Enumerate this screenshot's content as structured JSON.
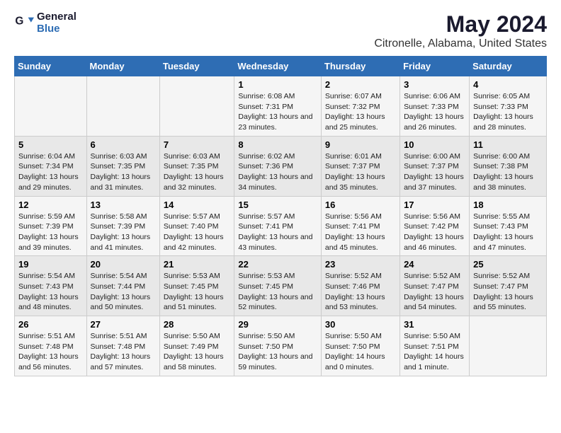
{
  "header": {
    "logo_line1": "General",
    "logo_line2": "Blue",
    "main_title": "May 2024",
    "subtitle": "Citronelle, Alabama, United States"
  },
  "weekdays": [
    "Sunday",
    "Monday",
    "Tuesday",
    "Wednesday",
    "Thursday",
    "Friday",
    "Saturday"
  ],
  "weeks": [
    [
      {
        "day": "",
        "info": ""
      },
      {
        "day": "",
        "info": ""
      },
      {
        "day": "",
        "info": ""
      },
      {
        "day": "1",
        "info": "Sunrise: 6:08 AM\nSunset: 7:31 PM\nDaylight: 13 hours\nand 23 minutes."
      },
      {
        "day": "2",
        "info": "Sunrise: 6:07 AM\nSunset: 7:32 PM\nDaylight: 13 hours\nand 25 minutes."
      },
      {
        "day": "3",
        "info": "Sunrise: 6:06 AM\nSunset: 7:33 PM\nDaylight: 13 hours\nand 26 minutes."
      },
      {
        "day": "4",
        "info": "Sunrise: 6:05 AM\nSunset: 7:33 PM\nDaylight: 13 hours\nand 28 minutes."
      }
    ],
    [
      {
        "day": "5",
        "info": "Sunrise: 6:04 AM\nSunset: 7:34 PM\nDaylight: 13 hours\nand 29 minutes."
      },
      {
        "day": "6",
        "info": "Sunrise: 6:03 AM\nSunset: 7:35 PM\nDaylight: 13 hours\nand 31 minutes."
      },
      {
        "day": "7",
        "info": "Sunrise: 6:03 AM\nSunset: 7:35 PM\nDaylight: 13 hours\nand 32 minutes."
      },
      {
        "day": "8",
        "info": "Sunrise: 6:02 AM\nSunset: 7:36 PM\nDaylight: 13 hours\nand 34 minutes."
      },
      {
        "day": "9",
        "info": "Sunrise: 6:01 AM\nSunset: 7:37 PM\nDaylight: 13 hours\nand 35 minutes."
      },
      {
        "day": "10",
        "info": "Sunrise: 6:00 AM\nSunset: 7:37 PM\nDaylight: 13 hours\nand 37 minutes."
      },
      {
        "day": "11",
        "info": "Sunrise: 6:00 AM\nSunset: 7:38 PM\nDaylight: 13 hours\nand 38 minutes."
      }
    ],
    [
      {
        "day": "12",
        "info": "Sunrise: 5:59 AM\nSunset: 7:39 PM\nDaylight: 13 hours\nand 39 minutes."
      },
      {
        "day": "13",
        "info": "Sunrise: 5:58 AM\nSunset: 7:39 PM\nDaylight: 13 hours\nand 41 minutes."
      },
      {
        "day": "14",
        "info": "Sunrise: 5:57 AM\nSunset: 7:40 PM\nDaylight: 13 hours\nand 42 minutes."
      },
      {
        "day": "15",
        "info": "Sunrise: 5:57 AM\nSunset: 7:41 PM\nDaylight: 13 hours\nand 43 minutes."
      },
      {
        "day": "16",
        "info": "Sunrise: 5:56 AM\nSunset: 7:41 PM\nDaylight: 13 hours\nand 45 minutes."
      },
      {
        "day": "17",
        "info": "Sunrise: 5:56 AM\nSunset: 7:42 PM\nDaylight: 13 hours\nand 46 minutes."
      },
      {
        "day": "18",
        "info": "Sunrise: 5:55 AM\nSunset: 7:43 PM\nDaylight: 13 hours\nand 47 minutes."
      }
    ],
    [
      {
        "day": "19",
        "info": "Sunrise: 5:54 AM\nSunset: 7:43 PM\nDaylight: 13 hours\nand 48 minutes."
      },
      {
        "day": "20",
        "info": "Sunrise: 5:54 AM\nSunset: 7:44 PM\nDaylight: 13 hours\nand 50 minutes."
      },
      {
        "day": "21",
        "info": "Sunrise: 5:53 AM\nSunset: 7:45 PM\nDaylight: 13 hours\nand 51 minutes."
      },
      {
        "day": "22",
        "info": "Sunrise: 5:53 AM\nSunset: 7:45 PM\nDaylight: 13 hours\nand 52 minutes."
      },
      {
        "day": "23",
        "info": "Sunrise: 5:52 AM\nSunset: 7:46 PM\nDaylight: 13 hours\nand 53 minutes."
      },
      {
        "day": "24",
        "info": "Sunrise: 5:52 AM\nSunset: 7:47 PM\nDaylight: 13 hours\nand 54 minutes."
      },
      {
        "day": "25",
        "info": "Sunrise: 5:52 AM\nSunset: 7:47 PM\nDaylight: 13 hours\nand 55 minutes."
      }
    ],
    [
      {
        "day": "26",
        "info": "Sunrise: 5:51 AM\nSunset: 7:48 PM\nDaylight: 13 hours\nand 56 minutes."
      },
      {
        "day": "27",
        "info": "Sunrise: 5:51 AM\nSunset: 7:48 PM\nDaylight: 13 hours\nand 57 minutes."
      },
      {
        "day": "28",
        "info": "Sunrise: 5:50 AM\nSunset: 7:49 PM\nDaylight: 13 hours\nand 58 minutes."
      },
      {
        "day": "29",
        "info": "Sunrise: 5:50 AM\nSunset: 7:50 PM\nDaylight: 13 hours\nand 59 minutes."
      },
      {
        "day": "30",
        "info": "Sunrise: 5:50 AM\nSunset: 7:50 PM\nDaylight: 14 hours\nand 0 minutes."
      },
      {
        "day": "31",
        "info": "Sunrise: 5:50 AM\nSunset: 7:51 PM\nDaylight: 14 hours\nand 1 minute."
      },
      {
        "day": "",
        "info": ""
      }
    ]
  ]
}
